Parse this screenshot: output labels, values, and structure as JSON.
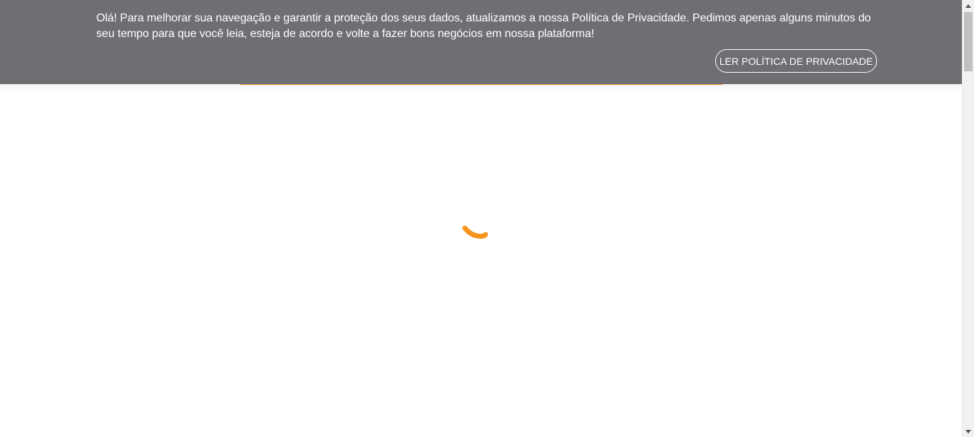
{
  "privacy_banner": {
    "message": "Olá! Para melhorar sua navegação e garantir a proteção dos seus dados, atualizamos a nossa Política de Privacidade. Pedimos apenas alguns minutos do seu tempo para que você leia, esteja de acordo e volte a fazer bons negócios em nossa plataforma!",
    "button_label": "LER POLÍTICA DE PRIVACIDADE",
    "background_color": "#6f6e73",
    "text_color": "#ffffff"
  },
  "main": {
    "spinner_icon": "loading-spinner-icon",
    "accent_color": "#f7941d"
  },
  "scrollbar": {
    "up_icon": "scroll-up-arrow-icon",
    "down_icon": "scroll-down-arrow-icon"
  }
}
